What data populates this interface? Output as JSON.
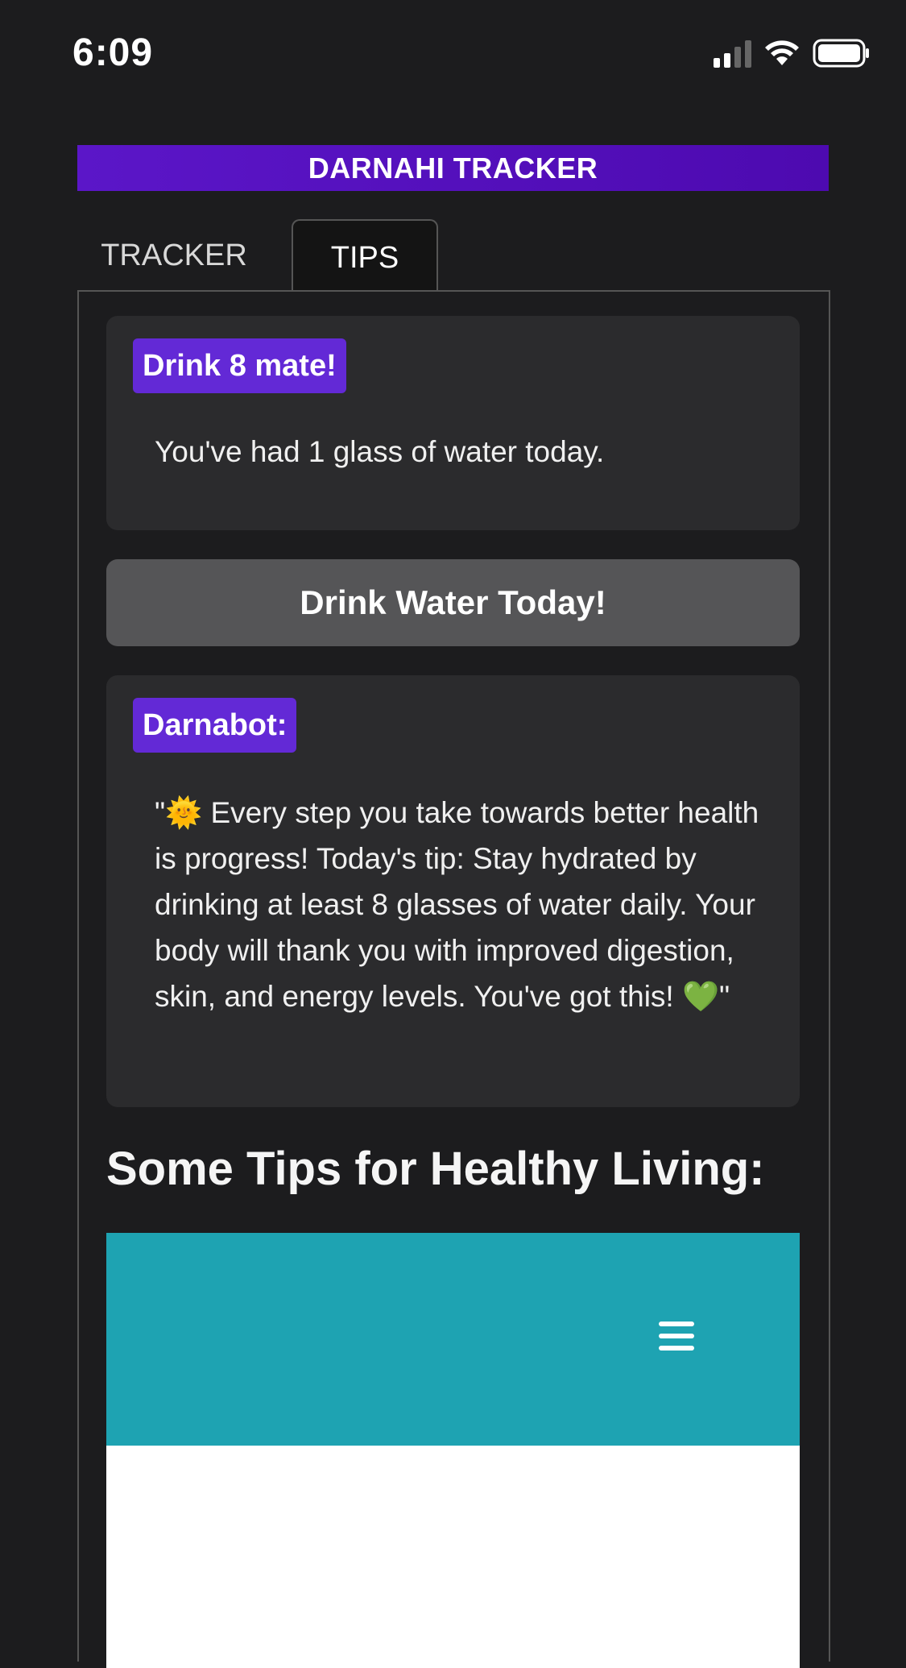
{
  "status_bar": {
    "time": "6:09"
  },
  "app": {
    "title": "DARNAHI TRACKER",
    "brand_color": "#5b16c8"
  },
  "tabs": [
    {
      "label": "TRACKER",
      "active": false
    },
    {
      "label": "TIPS",
      "active": true
    }
  ],
  "water_card": {
    "badge": "Drink 8 mate!",
    "message": "You've had 1 glass of water today."
  },
  "drink_button": {
    "label": "Drink Water Today!"
  },
  "bot_card": {
    "badge": "Darnabot:",
    "message": "\"🌞 Every step you take towards better health is progress! Today's tip: Stay hydrated by drinking at least 8 glasses of water daily. Your body will thank you with improved digestion, skin, and energy levels. You've got this! 💚\""
  },
  "tips_section": {
    "heading": "Some Tips for Healthy Living:",
    "embed_header_color": "#1ea3b2",
    "menu_icon": "hamburger-menu-icon"
  }
}
